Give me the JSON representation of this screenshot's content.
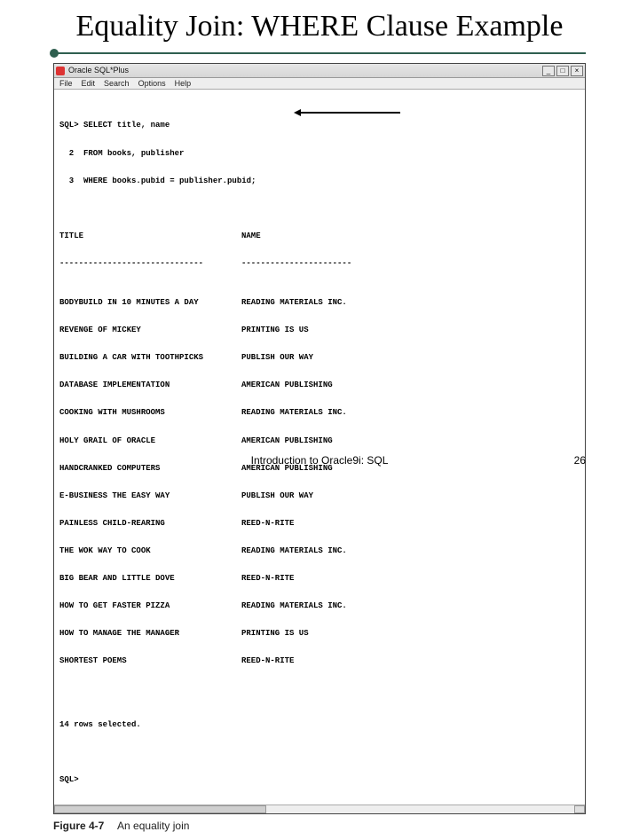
{
  "slide": {
    "title": "Equality Join: WHERE Clause Example",
    "footer_center": "Introduction to Oracle9i: SQL",
    "page_number": "26"
  },
  "window": {
    "title": "Oracle SQL*Plus",
    "menu": [
      "File",
      "Edit",
      "Search",
      "Options",
      "Help"
    ],
    "controls": {
      "min": "_",
      "max": "□",
      "close": "×"
    }
  },
  "sql": {
    "prompt": "SQL>",
    "lines": [
      "SQL> SELECT title, name",
      "  2  FROM books, publisher",
      "  3  WHERE books.pubid = publisher.pubid;"
    ],
    "columns": {
      "title": "TITLE",
      "name": "NAME"
    },
    "dash_title": "------------------------------",
    "dash_name": "-----------------------",
    "rows": [
      {
        "title": "BODYBUILD IN 10 MINUTES A DAY",
        "name": "READING MATERIALS INC."
      },
      {
        "title": "REVENGE OF MICKEY",
        "name": "PRINTING IS US"
      },
      {
        "title": "BUILDING A CAR WITH TOOTHPICKS",
        "name": "PUBLISH OUR WAY"
      },
      {
        "title": "DATABASE IMPLEMENTATION",
        "name": "AMERICAN PUBLISHING"
      },
      {
        "title": "COOKING WITH MUSHROOMS",
        "name": "READING MATERIALS INC."
      },
      {
        "title": "HOLY GRAIL OF ORACLE",
        "name": "AMERICAN PUBLISHING"
      },
      {
        "title": "HANDCRANKED COMPUTERS",
        "name": "AMERICAN PUBLISHING"
      },
      {
        "title": "E-BUSINESS THE EASY WAY",
        "name": "PUBLISH OUR WAY"
      },
      {
        "title": "PAINLESS CHILD-REARING",
        "name": "REED-N-RITE"
      },
      {
        "title": "THE WOK WAY TO COOK",
        "name": "READING MATERIALS INC."
      },
      {
        "title": "BIG BEAR AND LITTLE DOVE",
        "name": "REED-N-RITE"
      },
      {
        "title": "HOW TO GET FASTER PIZZA",
        "name": "READING MATERIALS INC."
      },
      {
        "title": "HOW TO MANAGE THE MANAGER",
        "name": "PRINTING IS US"
      },
      {
        "title": "SHORTEST POEMS",
        "name": "REED-N-RITE"
      }
    ],
    "rows_selected": "14 rows selected.",
    "final_prompt": "SQL>"
  },
  "figure": {
    "number": "Figure 4-7",
    "caption": "An equality join"
  }
}
